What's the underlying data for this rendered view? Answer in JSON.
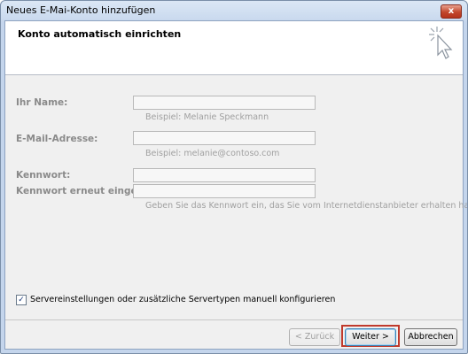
{
  "window": {
    "title": "Neues E-Mai-Konto hinzufügen",
    "close_label": "x"
  },
  "header": {
    "heading": "Konto automatisch einrichten"
  },
  "form": {
    "name_label": "Ihr Name:",
    "name_hint": "Beispiel: Melanie Speckmann",
    "email_label": "E-Mail-Adresse:",
    "email_hint": "Beispiel: melanie@contoso.com",
    "password_label": "Kennwort:",
    "password_repeat_label": "Kennwort erneut eingeben:",
    "password_hint": "Geben Sie das Kennwort ein, das Sie vom Internetdienstanbieter erhalten haben."
  },
  "options": {
    "manual_config_label": "Servereinstellungen oder zusätzliche Servertypen manuell konfigurieren",
    "manual_config_checked": true,
    "check_glyph": "✓"
  },
  "buttons": {
    "back_label": "< Zurück",
    "next_label": "Weiter >",
    "cancel_label": "Abbrechen"
  },
  "colors": {
    "highlight": "#c0392b"
  }
}
